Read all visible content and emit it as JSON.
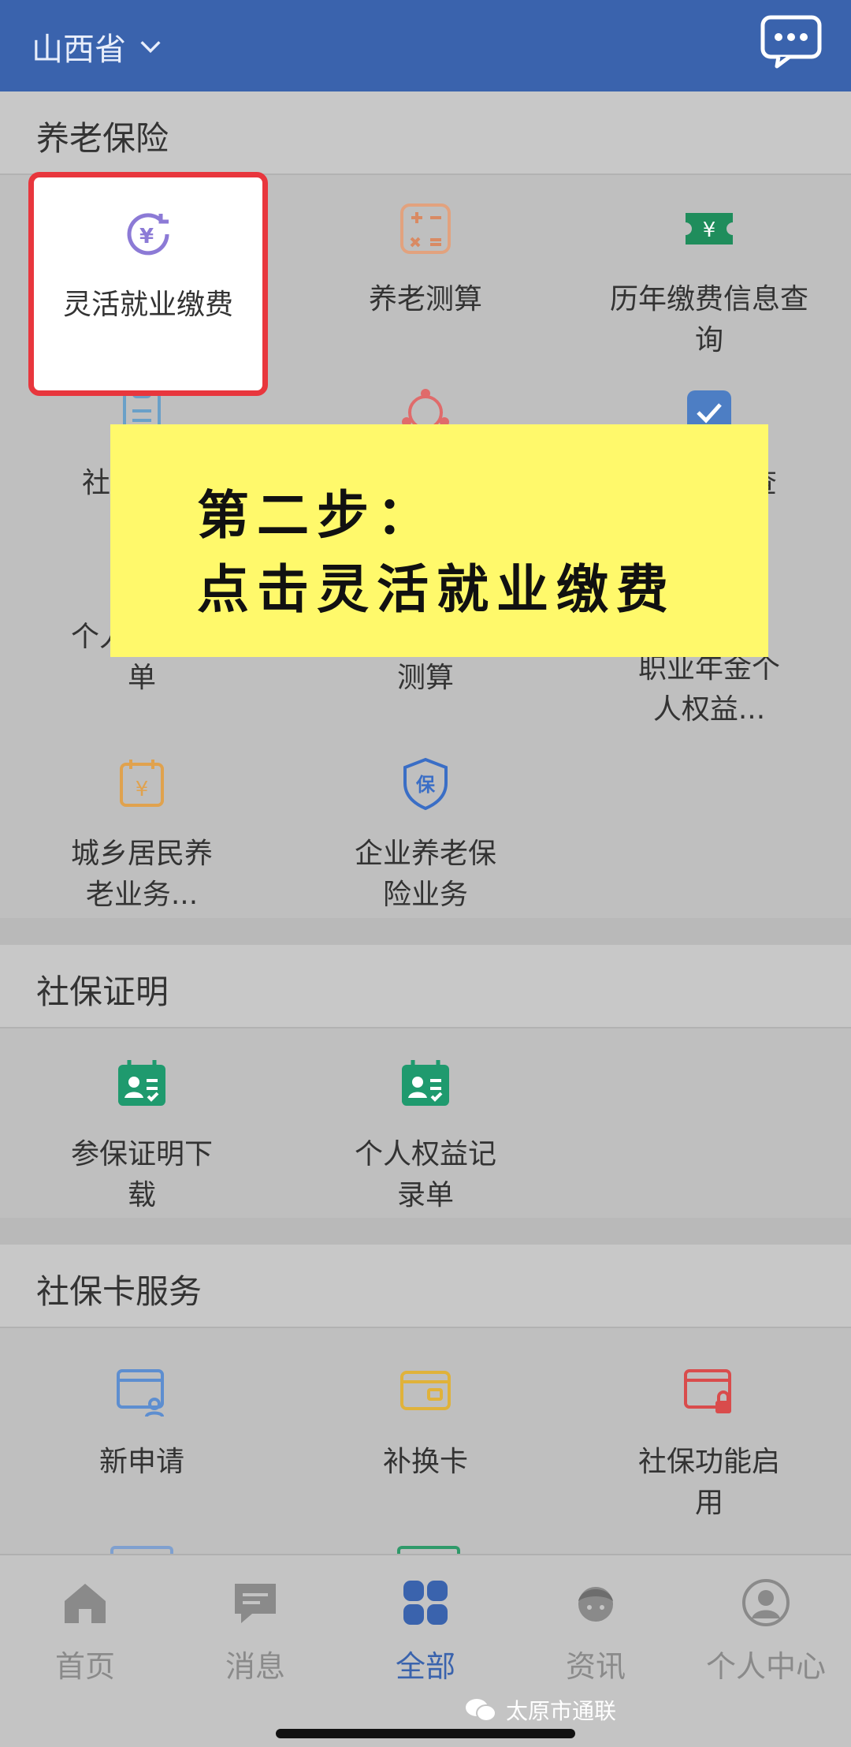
{
  "header": {
    "province": "山西省"
  },
  "sections": [
    {
      "title": "养老保险"
    },
    {
      "title": "社保证明"
    },
    {
      "title": "社保卡服务"
    }
  ],
  "pension": {
    "items": [
      {
        "label": "灵活就业缴费",
        "icon": "yuan-circle-icon"
      },
      {
        "label": "养老测算",
        "icon": "calculator-icon"
      },
      {
        "label": "历年缴费信息查询",
        "icon": "ticket-yuan-icon"
      },
      {
        "label": "社",
        "icon": "clipboard-icon"
      },
      {
        "label": "",
        "icon": "people-network-icon"
      },
      {
        "label": "查",
        "icon": "badge-check-icon"
      },
      {
        "label": "个人年度账单",
        "icon": "bill-icon"
      },
      {
        "label": "个性化养老测算",
        "icon": "calc-icon"
      },
      {
        "label": "职业年金个人权益...",
        "icon": "annuity-icon"
      },
      {
        "label": "城乡居民养老业务...",
        "icon": "calendar-yuan-icon"
      },
      {
        "label": "企业养老保险业务",
        "icon": "shield-bao-icon"
      }
    ]
  },
  "proof": {
    "items": [
      {
        "label": "参保证明下载",
        "icon": "id-card-calendar-icon"
      },
      {
        "label": "个人权益记录单",
        "icon": "id-card-calendar-icon"
      }
    ]
  },
  "card": {
    "items": [
      {
        "label": "新申请",
        "icon": "card-person-icon"
      },
      {
        "label": "补换卡",
        "icon": "card-wallet-icon"
      },
      {
        "label": "社保功能启用",
        "icon": "card-lock-icon"
      }
    ]
  },
  "banner": {
    "line1": "第二步：",
    "line2": "点击灵活就业缴费"
  },
  "tabbar": [
    {
      "label": "首页",
      "icon": "home-icon"
    },
    {
      "label": "消息",
      "icon": "message-icon"
    },
    {
      "label": "全部",
      "icon": "grid-icon",
      "active": true
    },
    {
      "label": "资讯",
      "icon": "news-person-icon"
    },
    {
      "label": "个人中心",
      "icon": "user-icon"
    }
  ],
  "watermark": {
    "text": "太原市通联"
  },
  "colors": {
    "header_bg": "#3a63ad",
    "highlight_border": "#e8363d",
    "banner_bg": "#fff96b",
    "active_tab": "#3a63ad"
  }
}
